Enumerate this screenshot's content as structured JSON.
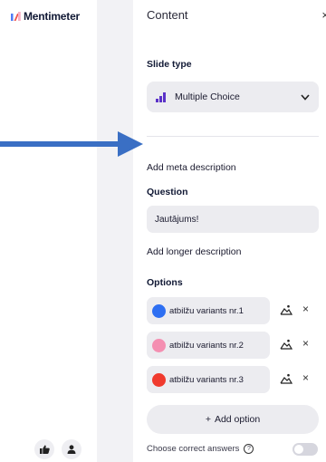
{
  "brand": {
    "name": "Mentimeter"
  },
  "panel": {
    "title": "Content",
    "close_glyph": "×"
  },
  "slide_type": {
    "label": "Slide type",
    "selected": "Multiple Choice",
    "icon": "bar-chart-icon",
    "accent": "#5b32c8"
  },
  "meta_description_link": "Add meta description",
  "question": {
    "label": "Question",
    "value": "Jautājums!"
  },
  "longer_description_link": "Add longer description",
  "options": {
    "label": "Options",
    "items": [
      {
        "text": "atbilžu variants nr.1",
        "color": "#2e6ff2"
      },
      {
        "text": "atbilžu variants nr.2",
        "color": "#f48fb1"
      },
      {
        "text": "atbilžu variants nr.3",
        "color": "#f03a2e"
      }
    ],
    "remove_glyph": "×"
  },
  "add_option": {
    "plus": "+",
    "label": "Add option"
  },
  "correct_answers": {
    "label": "Choose correct answers",
    "help": "?",
    "enabled": false
  },
  "footer_icons": [
    "thumbs-up-icon",
    "user-icon"
  ],
  "annotation_arrow_color": "#3a6fc4"
}
